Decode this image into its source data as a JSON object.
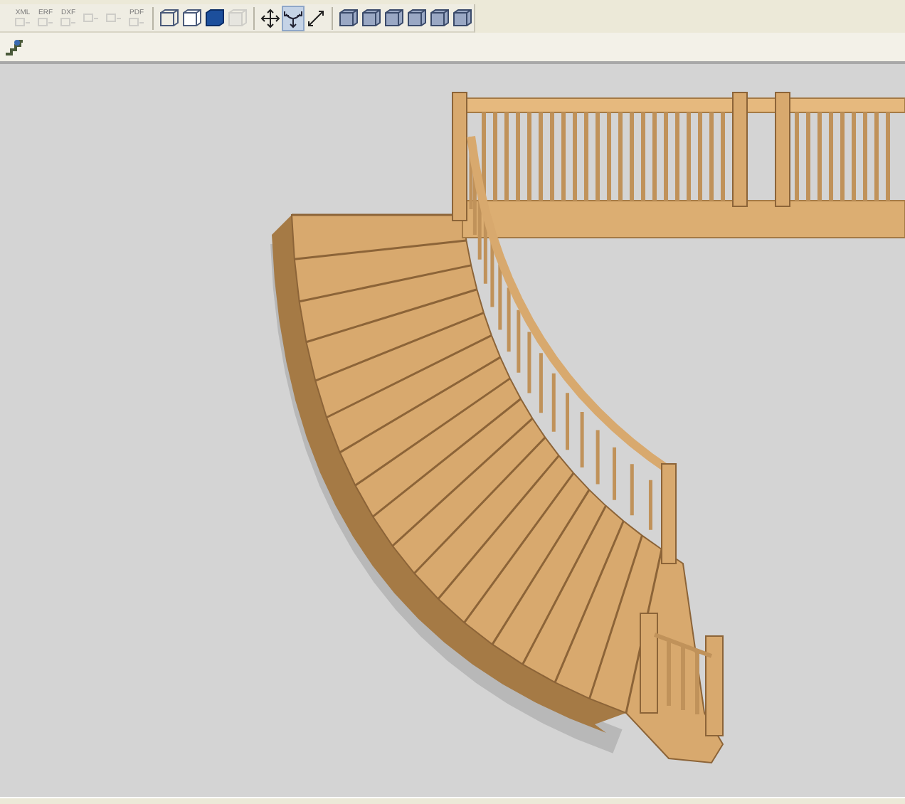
{
  "toolbar": {
    "buttons": [
      {
        "kind": "export",
        "label": "XML",
        "disabled": true,
        "selected": false
      },
      {
        "kind": "export",
        "label": "ERF",
        "disabled": true,
        "selected": false
      },
      {
        "kind": "export",
        "label": "DXF",
        "disabled": true,
        "selected": false
      },
      {
        "kind": "export",
        "disabled": true,
        "selected": false
      },
      {
        "kind": "export",
        "disabled": true,
        "selected": false
      },
      {
        "kind": "export",
        "label": "PDF",
        "disabled": true,
        "selected": false
      },
      {
        "kind": "sep"
      },
      {
        "kind": "wire",
        "disabled": false,
        "selected": false
      },
      {
        "kind": "hidden",
        "disabled": false,
        "selected": false
      },
      {
        "kind": "solid",
        "disabled": false,
        "selected": false
      },
      {
        "kind": "wire",
        "disabled": true,
        "selected": false
      },
      {
        "kind": "sep"
      },
      {
        "kind": "move",
        "disabled": false,
        "selected": false
      },
      {
        "kind": "rotate",
        "disabled": false,
        "selected": true
      },
      {
        "kind": "measure",
        "disabled": false,
        "selected": false
      },
      {
        "kind": "sep"
      },
      {
        "kind": "cube",
        "disabled": false,
        "selected": false
      },
      {
        "kind": "cube",
        "disabled": false,
        "selected": false
      },
      {
        "kind": "cube",
        "disabled": false,
        "selected": false
      },
      {
        "kind": "cube",
        "disabled": false,
        "selected": false
      },
      {
        "kind": "cube",
        "disabled": false,
        "selected": false
      },
      {
        "kind": "cube",
        "disabled": false,
        "selected": false
      }
    ]
  }
}
